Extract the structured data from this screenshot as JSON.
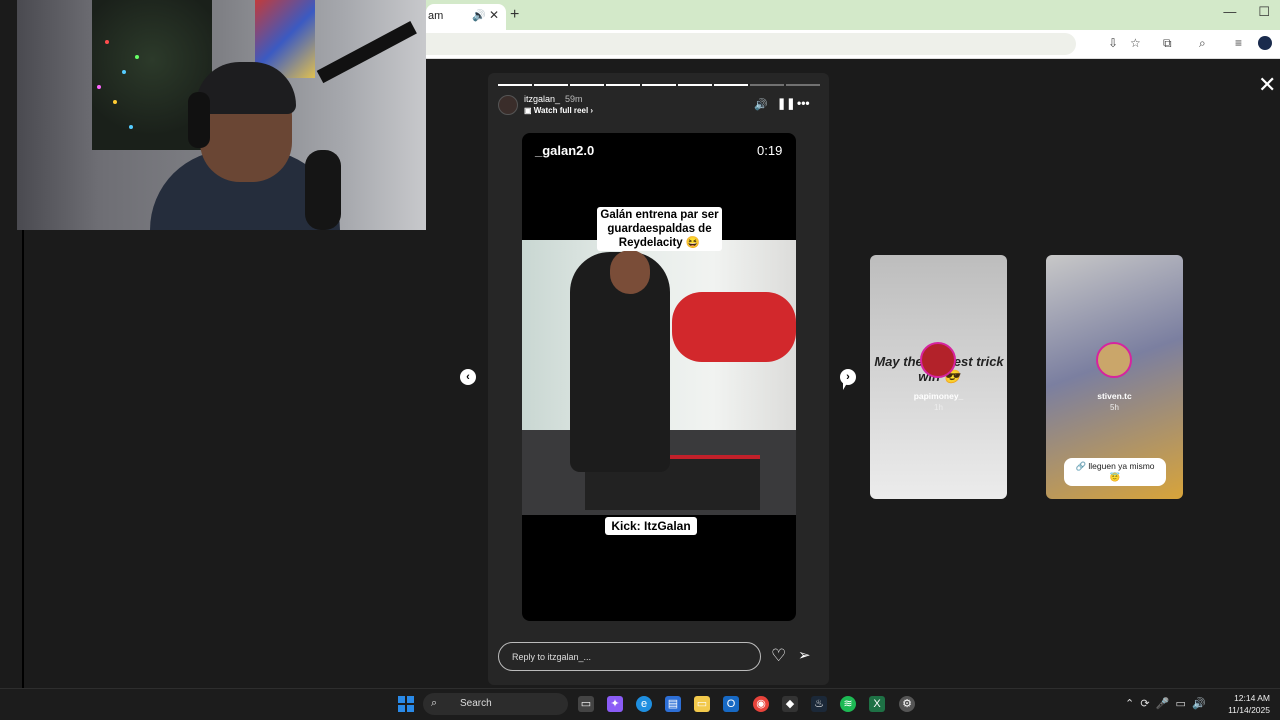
{
  "browser": {
    "tab_title": "am",
    "tab_audio_icon": "speaker-icon",
    "tab_close": "✕",
    "new_tab": "+",
    "window_minimize": "—",
    "window_maximize": "☐"
  },
  "story": {
    "username": "itzgalan_",
    "time": "59m",
    "watch_full_reel": "Watch full reel",
    "video_handle": "_galan2.0",
    "video_timer": "0:19",
    "caption": "Galán entrena par ser guardaespaldas de Reydelacity 😆",
    "kick_label": "Kick: ItzGalan",
    "reply_placeholder": "Reply to itzgalan_...",
    "progress_segments": 9,
    "progress_completed": 7
  },
  "previews": [
    {
      "username": "papimoney_",
      "time": "1h",
      "text": "May the biggest trick win 😎"
    },
    {
      "username": "stiven.tc",
      "time": "5h",
      "sticker": "🔗 lleguen ya mismo 😇"
    }
  ],
  "taskbar": {
    "search_label": "Search",
    "clock_time": "12:14 AM",
    "clock_date": "11/14/2025"
  },
  "colors": {
    "tab_bar": "#d3e9c9",
    "story_bg": "#262626",
    "page_bg": "#1b1b1b",
    "preview_ring": "#d6249f"
  }
}
